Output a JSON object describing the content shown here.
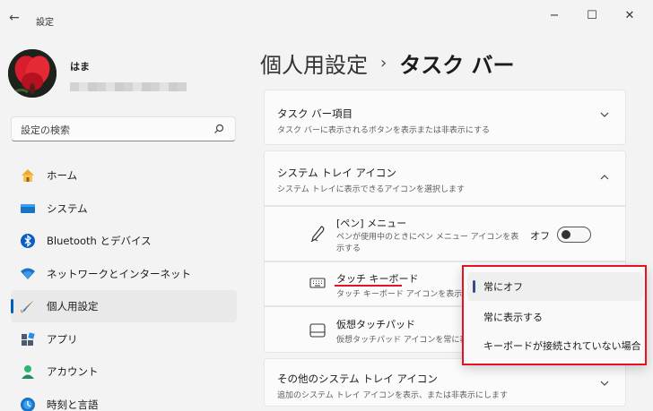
{
  "window": {
    "back_glyph": "←",
    "title": "設定",
    "minimize_glyph": "−",
    "maximize_glyph": "☐",
    "close_glyph": "✕"
  },
  "user": {
    "name": "はま"
  },
  "search": {
    "placeholder": "設定の検索"
  },
  "nav": [
    {
      "label": "ホーム",
      "icon": "home-icon"
    },
    {
      "label": "システム",
      "icon": "system-icon"
    },
    {
      "label": "Bluetooth とデバイス",
      "icon": "bluetooth-icon"
    },
    {
      "label": "ネットワークとインターネット",
      "icon": "network-icon"
    },
    {
      "label": "個人用設定",
      "icon": "brush-icon",
      "active": true
    },
    {
      "label": "アプリ",
      "icon": "apps-icon"
    },
    {
      "label": "アカウント",
      "icon": "account-icon"
    },
    {
      "label": "時刻と言語",
      "icon": "time-language-icon"
    }
  ],
  "breadcrumb": {
    "parent": "個人用設定",
    "separator": "›",
    "current": "タスク バー"
  },
  "sections": {
    "taskbar_items": {
      "title": "タスク バー項目",
      "subtitle": "タスク バーに表示されるボタンを表示または非表示にする"
    },
    "system_tray": {
      "title": "システム トレイ アイコン",
      "subtitle": "システム トレイに表示できるアイコンを選択します"
    },
    "pen_menu": {
      "title": "[ペン] メニュー",
      "desc_line1": "ペンが使用中のときにペン メニュー アイコンを表",
      "desc_line2": "示する",
      "toggle_label": "オフ",
      "toggle_on": false
    },
    "touch_keyboard": {
      "title": "タッチ キーボード",
      "desc": "タッチ キーボード アイコンを表示"
    },
    "virtual_touchpad": {
      "title": "仮想タッチパッド",
      "desc": "仮想タッチパッド アイコンを常に表示"
    },
    "other_tray": {
      "title": "その他のシステム トレイ アイコン",
      "subtitle": "追加のシステム トレイ アイコンを表示、または非表示にします"
    }
  },
  "dropdown": {
    "options": [
      "常にオフ",
      "常に表示する",
      "キーボードが接続されていない場合"
    ],
    "selected": "常にオフ"
  },
  "colors": {
    "accent": "#005fb8",
    "highlight_red": "#e81123"
  }
}
